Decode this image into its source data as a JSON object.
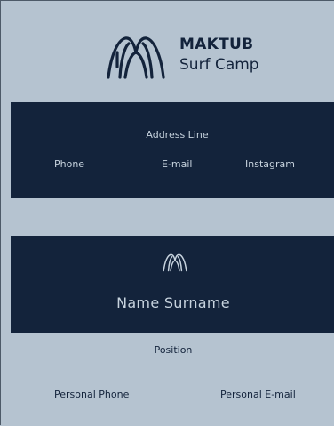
{
  "card_front": {
    "brand_name": "MAKTUB",
    "brand_subtitle": "Surf Camp",
    "address": "Address Line",
    "phone": "Phone",
    "email": "E-mail",
    "instagram": "Instagram",
    "logo_icon": "double-arch-wave-icon"
  },
  "card_back": {
    "name": "Name Surname",
    "position": "Position",
    "personal_phone": "Personal Phone",
    "personal_email": "Personal E-mail",
    "logo_icon": "double-arch-wave-icon"
  },
  "colors": {
    "navy": "#13233b",
    "light_blue_gray": "#b5c3d0",
    "light_text": "#c7d3de"
  }
}
